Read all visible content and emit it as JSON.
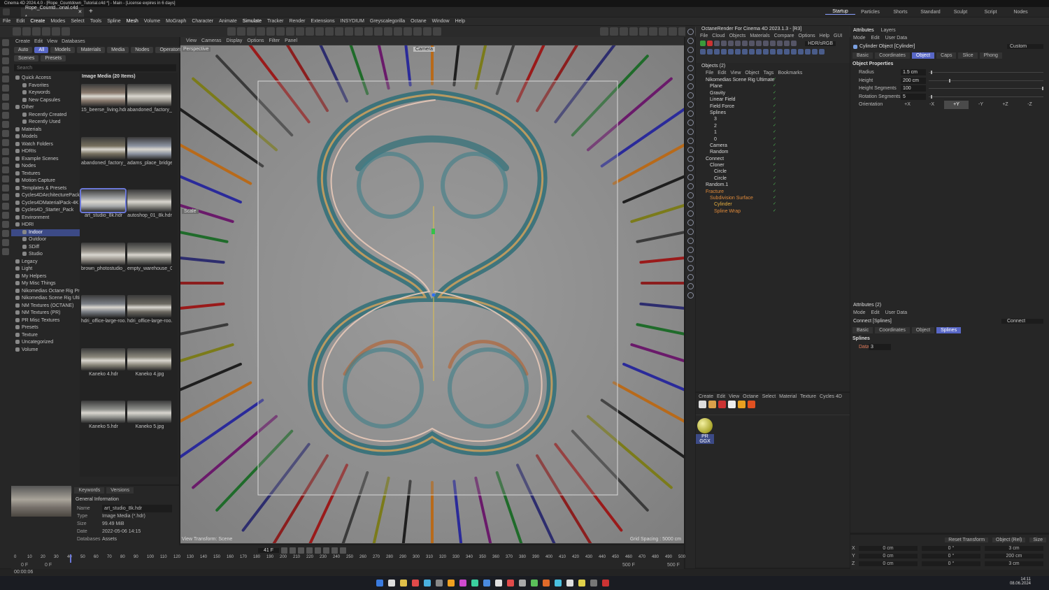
{
  "window": {
    "title": "Cinema 4D 2024.4.0 - [Rope_Countdown_Tutorial.c4d *] - Main - [License expires in 6 days]",
    "doc_tab": "Rope_Countd...orial.c4d *",
    "add_tab": "+",
    "close_tab": "✕"
  },
  "menu": [
    "File",
    "Edit",
    "Create",
    "Modes",
    "Select",
    "Tools",
    "Spline",
    "Mesh",
    "Volume",
    "MoGraph",
    "Character",
    "Animate",
    "Simulate",
    "Tracker",
    "Render",
    "Extensions",
    "INSYDIUM",
    "Greyscalegorilla",
    "Octane",
    "Window",
    "Help"
  ],
  "layouts": [
    "Startup",
    "Particles",
    "Shorts",
    "Standard",
    "Sculpt",
    "Script",
    "Nodes"
  ],
  "asset_browser": {
    "menu": [
      "Create",
      "Edit",
      "View",
      "Databases"
    ],
    "filters": [
      "Auto",
      "All",
      "Models",
      "Materials",
      "Media",
      "Nodes",
      "Operators"
    ],
    "tabs2": [
      "Scenes",
      "Presets"
    ],
    "search_placeholder": "Search",
    "header": "Image Media (20 Items)",
    "tree": [
      "Quick Access",
      "Favorites",
      "Keywords",
      "New Capsules",
      "Other",
      "Recently Created",
      "Recently Used",
      "Materials",
      "Models",
      "Watch Folders",
      "HDRIs",
      "Example Scenes",
      "Nodes",
      "Textures",
      "Motion Capture",
      "Templates & Presets",
      "Cycles4DArchitecturePack-4K",
      "Cycles4DMaterialPack-4K",
      "Cycles4D_Starter_Pack",
      "Environment",
      "HDRI",
      "Indoor",
      "Outdoor",
      "SDiff",
      "Studio",
      "Legacy",
      "Light",
      "My Helpers",
      "My Misc Things",
      "Nikomedias Octane Rig Pro",
      "Nikomedias Scene Rig Ultimate",
      "NM Textures (OCTANE)",
      "NM Textures (PR)",
      "PR Misc Textures",
      "Presets",
      "Texture",
      "Uncategorized",
      "Volume"
    ],
    "selected_tree": "Indoor",
    "items": [
      {
        "name": "15_beerse_living.hdr",
        "color": "#8a7a6e"
      },
      {
        "name": "abandoned_factory_...",
        "color": "#9c9890"
      },
      {
        "name": "abandoned_factory_...",
        "color": "#76705f"
      },
      {
        "name": "adams_place_bridge_...",
        "color": "#8c93a0"
      },
      {
        "name": "art_studio_8k.hdr",
        "color": "#a6a8aa"
      },
      {
        "name": "autoshop_01_8k.hdr",
        "color": "#8f8e88"
      },
      {
        "name": "brown_photostudio_...",
        "color": "#9d9890"
      },
      {
        "name": "empty_warehouse_0...",
        "color": "#85847d"
      },
      {
        "name": "hdri_office-large-roo...",
        "color": "#7b7f86"
      },
      {
        "name": "hdri_office-large-roo...",
        "color": "#6d6a62"
      },
      {
        "name": "Kaneko 4.hdr",
        "color": "#8b887c"
      },
      {
        "name": "Kaneko 4.jpg",
        "color": "#8b887c"
      },
      {
        "name": "Kaneko 5.hdr",
        "color": "#90918d"
      },
      {
        "name": "Kaneko 5.jpg",
        "color": "#90918d"
      }
    ],
    "selected_item": "art_studio_8k.hdr"
  },
  "info": {
    "tabs": [
      "Info",
      "Dependencies",
      "Keywords",
      "Versions"
    ],
    "section": "General Information",
    "rows": [
      [
        "Name",
        "art_studio_8k.hdr"
      ],
      [
        "Type",
        "Image Media (*.hdr)"
      ],
      [
        "Size",
        "99.49 MiB"
      ],
      [
        "Date",
        "2022-05-06 14:15"
      ],
      [
        "Databases",
        "Assets"
      ]
    ]
  },
  "viewport": {
    "menu": [
      "View",
      "Cameras",
      "Display",
      "Options",
      "Filter",
      "Panel"
    ],
    "perspective": "Perspective",
    "camera": "Camera",
    "scale_label": "Scale",
    "status_left": "View Transform: Scene",
    "status_right": "Grid Spacing : 5000 cm"
  },
  "timeline": {
    "current_frame": "41 F",
    "start": "0 F",
    "start2": "0 F",
    "end": "500 F",
    "end2": "500 F",
    "ticks": [
      "0",
      "10",
      "20",
      "30",
      "40",
      "41",
      "50",
      "60",
      "70",
      "80",
      "90",
      "100",
      "110",
      "120",
      "130",
      "140",
      "150",
      "160",
      "170",
      "180",
      "190",
      "200",
      "210",
      "220",
      "230",
      "240",
      "250",
      "260",
      "270",
      "280",
      "290",
      "300",
      "310",
      "320",
      "330",
      "340",
      "350",
      "360",
      "370",
      "380",
      "390",
      "400",
      "410",
      "420",
      "430",
      "440",
      "450",
      "460",
      "470",
      "480",
      "490",
      "500"
    ],
    "timecode": "00:00:06"
  },
  "octane": {
    "title": "OctaneRender For Cinema 4D 2023.1.3 - [R3]",
    "menu": [
      "File",
      "Cloud",
      "Objects",
      "Materials",
      "Compare",
      "Options",
      "Help",
      "GUI"
    ],
    "colorspace": "HDR/sRGB"
  },
  "objects": {
    "header": "Objects (2)",
    "menu": [
      "File",
      "Edit",
      "View",
      "Object",
      "Tags",
      "Bookmarks"
    ],
    "items": [
      {
        "name": "Nikomedias Scene Rig Ultimate",
        "indent": 0,
        "color": "#d8d8d8"
      },
      {
        "name": "Plane",
        "indent": 1,
        "color": "#d8d8d8"
      },
      {
        "name": "Gravity",
        "indent": 1,
        "color": "#d8d8d8"
      },
      {
        "name": "Linear Field",
        "indent": 1,
        "color": "#d8d8d8"
      },
      {
        "name": "Field Force",
        "indent": 1,
        "color": "#d8d8d8"
      },
      {
        "name": "Splines",
        "indent": 1,
        "color": "#d8d8d8"
      },
      {
        "name": "3",
        "indent": 2,
        "color": "#d8d8d8"
      },
      {
        "name": "2",
        "indent": 2,
        "color": "#d8d8d8"
      },
      {
        "name": "1",
        "indent": 2,
        "color": "#d8d8d8"
      },
      {
        "name": "0",
        "indent": 2,
        "color": "#d8d8d8"
      },
      {
        "name": "Camera",
        "indent": 1,
        "color": "#d8d8d8"
      },
      {
        "name": "Random",
        "indent": 1,
        "color": "#d8d8d8"
      },
      {
        "name": "Connect",
        "indent": 0,
        "color": "#d8d8d8"
      },
      {
        "name": "Cloner",
        "indent": 1,
        "color": "#d8d8d8"
      },
      {
        "name": "Circle",
        "indent": 2,
        "color": "#d8d8d8"
      },
      {
        "name": "Circle",
        "indent": 2,
        "color": "#d8d8d8"
      },
      {
        "name": "Random.1",
        "indent": 0,
        "color": "#d8d8d8"
      },
      {
        "name": "Fracture",
        "indent": 0,
        "color": "#e08a3a"
      },
      {
        "name": "Subdivision Surface",
        "indent": 1,
        "color": "#e08a3a"
      },
      {
        "name": "Cylinder",
        "indent": 2,
        "color": "#e8b040"
      },
      {
        "name": "Spline Wrap",
        "indent": 2,
        "color": "#e08a3a"
      }
    ]
  },
  "material": {
    "menu": [
      "Create",
      "Edit",
      "View",
      "Octane",
      "Select",
      "Material",
      "Texture",
      "Cycles 4D"
    ],
    "item": "PR GGX"
  },
  "attributes": {
    "tabs": [
      "Attributes",
      "Layers"
    ],
    "menu": [
      "Mode",
      "Edit",
      "User Data"
    ],
    "object": "Cylinder Object [Cylinder]",
    "preset": "Custom",
    "obj_tabs": [
      "Basic",
      "Coordinates",
      "Object",
      "Caps",
      "Slice",
      "Phong"
    ],
    "selected_tab": "Object",
    "section": "Object Properties",
    "props": [
      [
        "Radius",
        "1.5 cm"
      ],
      [
        "Height",
        "200 cm"
      ],
      [
        "Height Segments",
        "100"
      ],
      [
        "Rotation Segments",
        "5"
      ]
    ],
    "orientation_label": "Orientation",
    "orientation": [
      "+X",
      "-X",
      "+Y",
      "-Y",
      "+Z",
      "-Z"
    ],
    "orientation_sel": "+Y"
  },
  "attributes2": {
    "header": "Attributes (2)",
    "menu": [
      "Mode",
      "Edit",
      "User Data"
    ],
    "object": "Connect [Splines]",
    "object_right": "Connect",
    "tabs": [
      "Basic",
      "Coordinates",
      "Object",
      "Splines"
    ],
    "selected_tab": "Splines",
    "section": "Splines",
    "data_label": "Data",
    "data_value": "3"
  },
  "coords": {
    "buttons": [
      "Reset Transform",
      "Object (Rel)",
      "Size"
    ],
    "rows": [
      [
        "X",
        "0 cm",
        "0 °",
        "3 cm"
      ],
      [
        "Y",
        "0 cm",
        "0 °",
        "200 cm"
      ],
      [
        "Z",
        "0 cm",
        "0 °",
        "3 cm"
      ]
    ]
  },
  "taskbar": {
    "time": "14:11",
    "date": "08.06.2024"
  },
  "colors": {
    "accent": "#5867c6",
    "selected_tree": "#3c4a86"
  }
}
